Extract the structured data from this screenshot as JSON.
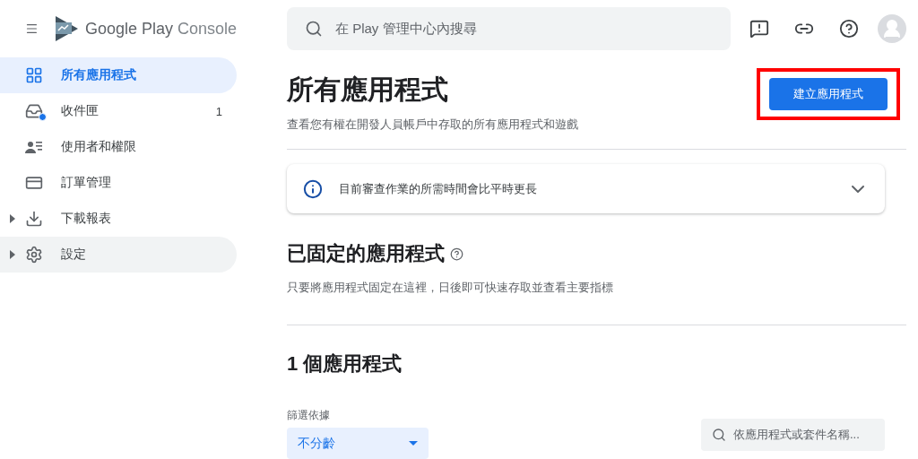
{
  "header": {
    "brand": {
      "name": "Google Play",
      "product": "Console"
    },
    "search": {
      "placeholder": "在 Play 管理中心內搜尋"
    }
  },
  "sidebar": {
    "items": [
      {
        "label": "所有應用程式",
        "kind": "grid",
        "selected": true,
        "highlighted": false,
        "expandable": false
      },
      {
        "label": "收件匣",
        "kind": "inbox",
        "selected": false,
        "highlighted": false,
        "expandable": false,
        "count": "1",
        "unread": true
      },
      {
        "label": "使用者和權限",
        "kind": "users",
        "selected": false,
        "highlighted": false,
        "expandable": false
      },
      {
        "label": "訂單管理",
        "kind": "card",
        "selected": false,
        "highlighted": false,
        "expandable": false
      },
      {
        "label": "下載報表",
        "kind": "download",
        "selected": false,
        "highlighted": false,
        "expandable": true
      },
      {
        "label": "設定",
        "kind": "gear",
        "selected": false,
        "highlighted": true,
        "expandable": true
      }
    ]
  },
  "page": {
    "title": "所有應用程式",
    "subtitle": "查看您有權在開發人員帳戶中存取的所有應用程式和遊戲",
    "create_button": {
      "label": "建立應用程式",
      "highlighted": true
    },
    "notice": {
      "text": "目前審查作業的所需時間會比平時更長",
      "expanded": false
    },
    "pinned": {
      "title": "已固定的應用程式",
      "description": "只要將應用程式固定在這裡，日後即可快速存取並查看主要指標"
    },
    "apps": {
      "title": "1 個應用程式",
      "filter": {
        "label": "篩選依據",
        "value": "不分齡"
      },
      "search": {
        "placeholder": "依應用程式或套件名稱..."
      }
    }
  }
}
